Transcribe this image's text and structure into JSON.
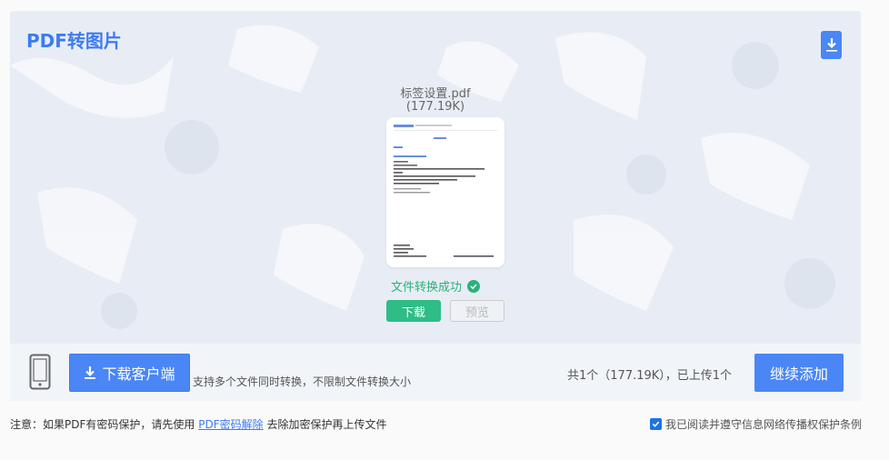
{
  "header": {
    "title": "PDF转图片"
  },
  "icons": {
    "corner_download": "download-icon",
    "status_check": "check-circle-icon",
    "phone": "mobile-phone-icon",
    "client_download": "download-icon",
    "agree_check": "checkbox-checked-icon"
  },
  "file": {
    "name": "标签设置.pdf",
    "size": "(177.19K)",
    "status": "文件转换成功",
    "download_label": "下载",
    "preview_label": "预览"
  },
  "bottom_bar": {
    "client_button_label": "下载客户端",
    "client_description": "支持多个文件同时转换，不限制文件转换大小",
    "count_text": "共1个（177.19K），已上传1个",
    "add_button_label": "继续添加"
  },
  "footer": {
    "notice_prefix": "注意：如果PDF有密码保护，请先使用",
    "notice_link": "PDF密码解除",
    "notice_suffix": "去除加密保护再上传文件",
    "agree_text": "我已阅读并遵守信息网络传播权保护条例",
    "agree_checked": true
  },
  "colors": {
    "accent": "#4a86f5",
    "title": "#3e7bf0",
    "success": "#2ebd85",
    "panel_bg": "#e8edf5"
  }
}
